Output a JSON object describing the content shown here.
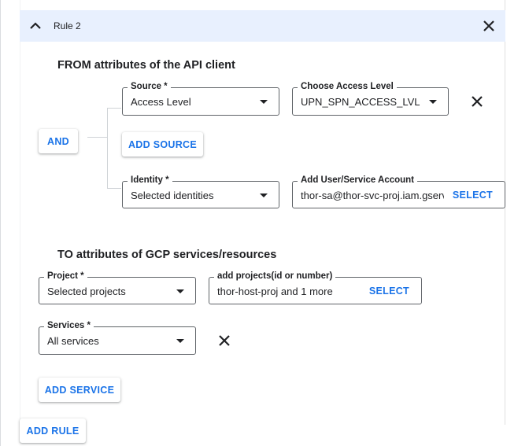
{
  "rule": {
    "title": "Rule 2"
  },
  "from": {
    "title": "FROM attributes of the API client",
    "operator_label": "AND",
    "source": {
      "label": "Source *",
      "value": "Access Level"
    },
    "access_level": {
      "label": "Choose Access Level",
      "value": "UPN_SPN_ACCESS_LVL a..."
    },
    "add_source_label": "ADD SOURCE",
    "identity": {
      "label": "Identity *",
      "value": "Selected identities"
    },
    "account": {
      "label": "Add User/Service Account",
      "value": "thor-sa@thor-svc-proj.iam.gserviceaccount.com",
      "select_label": "SELECT"
    }
  },
  "to": {
    "title": "TO attributes of GCP services/resources",
    "project": {
      "label": "Project *",
      "value": "Selected projects"
    },
    "projects": {
      "label": "add projects(id or number)",
      "value": "thor-host-proj and 1 more",
      "select_label": "SELECT"
    },
    "services": {
      "label": "Services *",
      "value": "All services"
    },
    "add_service_label": "ADD SERVICE"
  },
  "add_rule_label": "ADD RULE",
  "colors": {
    "accent": "#1a73e8",
    "header_bg": "#e8f0fe",
    "border": "#5f6368"
  }
}
